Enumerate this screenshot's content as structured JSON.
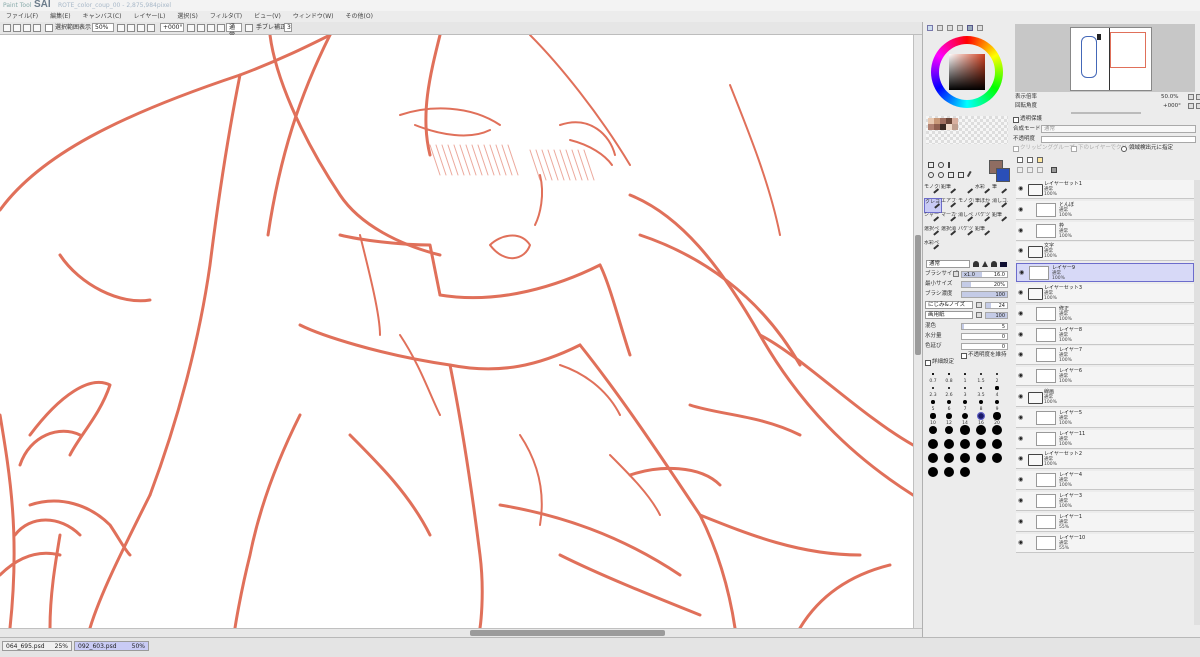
{
  "titlebar": {
    "app_logo": "Paint Tool",
    "app_name": "SAI",
    "document_title": "ROTE_color_coup_00 - 2,875,984pixel"
  },
  "menu": [
    "ファイル(F)",
    "編集(E)",
    "キャンバス(C)",
    "レイヤー(L)",
    "選択(S)",
    "フィルタ(T)",
    "ビュー(V)",
    "ウィンドウ(W)",
    "その他(O)"
  ],
  "toolbar": {
    "selection_label": "選択範囲表示",
    "zoom": "50%",
    "angle": "+000°",
    "blend_mode": "通常",
    "stabilizer_label": "手ブレ補正",
    "stabilizer_value": "3"
  },
  "navigator": {
    "zoom_label": "表示倍率",
    "zoom_value": "50.0%",
    "angle_label": "回転角度",
    "angle_value": "+000°"
  },
  "layer_props": {
    "guard_label": "透明保護",
    "blend_label": "合成モード",
    "blend_value": "通常",
    "opacity_label": "不透明度",
    "clip_label": "クリッピンググループ",
    "protect_label": "下のレイヤーでクリッピング",
    "sample_label": "領域検出元に指定"
  },
  "tools": {
    "row1": [
      "モノクロ鉛",
      "鉛筆",
      "",
      "水彩",
      "筆"
    ],
    "row2": [
      "クレヨン",
      "エアブラシ",
      "モノクロエ",
      "筆ぼかし",
      "消しゴム"
    ],
    "row3": [
      "シャープ",
      "マーカー",
      "消しペン",
      "バケツ",
      "鉛筆"
    ],
    "row4": [
      "選択ペン",
      "選択消し",
      "バケツ",
      "鉛筆"
    ],
    "row5": [
      "水彩ペン"
    ]
  },
  "brush": {
    "blend_value": "通常",
    "size_label": "ブラシサイズ",
    "size_mult": "x1.0",
    "size_value": "16.0",
    "min_label": "最小サイズ",
    "min_value": "20%",
    "density_label": "ブラシ濃度",
    "density_value": "100",
    "texture_label": "にじみ&ノイズ",
    "texture_value": "24",
    "paper_label": "画用紙",
    "paper_value": "100",
    "mix_label": "混色",
    "mix_value": "5",
    "water_label": "水分量",
    "water_value": "0",
    "persist_label": "色延び",
    "persist_value": "0",
    "keep_opacity_label": "不透明度を維持",
    "detail_label": "詳細設定"
  },
  "brush_sizes": [
    "0.7",
    "0.8",
    "1",
    "1.5",
    "2",
    "2.3",
    "2.6",
    "3",
    "3.5",
    "4",
    "5",
    "6",
    "7",
    "8",
    "9",
    "10",
    "12",
    "14",
    "16",
    "20",
    "25",
    "30",
    "35",
    "40",
    "50",
    "60",
    "70",
    "80",
    "100",
    "120",
    "160",
    "200",
    "250",
    "300",
    "350",
    "400",
    "450",
    "500"
  ],
  "layers": [
    {
      "name": "レイヤーセット1",
      "mode": "通常",
      "opacity": "100%",
      "type": "folder",
      "indent": 0
    },
    {
      "name": "とんぼ",
      "mode": "通常",
      "opacity": "100%",
      "type": "layer",
      "indent": 1
    },
    {
      "name": "枠",
      "mode": "通常",
      "opacity": "100%",
      "type": "layer",
      "indent": 1
    },
    {
      "name": "文字",
      "mode": "通常",
      "opacity": "100%",
      "type": "folder",
      "indent": 0
    },
    {
      "name": "レイヤー9",
      "mode": "通常",
      "opacity": "100%",
      "type": "layer",
      "indent": 0,
      "selected": true
    },
    {
      "name": "レイヤーセット3",
      "mode": "通常",
      "opacity": "100%",
      "type": "folder",
      "indent": 0
    },
    {
      "name": "修正",
      "mode": "通常",
      "opacity": "100%",
      "type": "layer",
      "indent": 1
    },
    {
      "name": "レイヤー8",
      "mode": "通常",
      "opacity": "100%",
      "type": "layer",
      "indent": 1
    },
    {
      "name": "レイヤー7",
      "mode": "通常",
      "opacity": "100%",
      "type": "layer",
      "indent": 1
    },
    {
      "name": "レイヤー6",
      "mode": "通常",
      "opacity": "100%",
      "type": "layer",
      "indent": 1
    },
    {
      "name": "線画",
      "mode": "通常",
      "opacity": "100%",
      "type": "folder",
      "indent": 0
    },
    {
      "name": "レイヤー5",
      "mode": "通常",
      "opacity": "100%",
      "type": "layer",
      "indent": 1
    },
    {
      "name": "レイヤー11",
      "mode": "通常",
      "opacity": "100%",
      "type": "layer",
      "indent": 1
    },
    {
      "name": "レイヤーセット2",
      "mode": "通常",
      "opacity": "100%",
      "type": "folder",
      "indent": 0
    },
    {
      "name": "レイヤー4",
      "mode": "通常",
      "opacity": "100%",
      "type": "layer",
      "indent": 1
    },
    {
      "name": "レイヤー3",
      "mode": "通常",
      "opacity": "100%",
      "type": "layer",
      "indent": 1
    },
    {
      "name": "レイヤー1",
      "mode": "通常",
      "opacity": "55%",
      "type": "layer",
      "indent": 1
    },
    {
      "name": "レイヤー10",
      "mode": "通常",
      "opacity": "55%",
      "type": "layer",
      "indent": 1
    }
  ],
  "file_tabs": [
    {
      "name": "064_695.psd",
      "zoom": "25%",
      "active": false
    },
    {
      "name": "092_603.psd",
      "zoom": "50%",
      "active": true
    }
  ],
  "colors": {
    "line": "#e0705a",
    "primary": "#8f6d62",
    "secondary": "#2a4fb8",
    "selected_layer": "#d7d9f7"
  }
}
